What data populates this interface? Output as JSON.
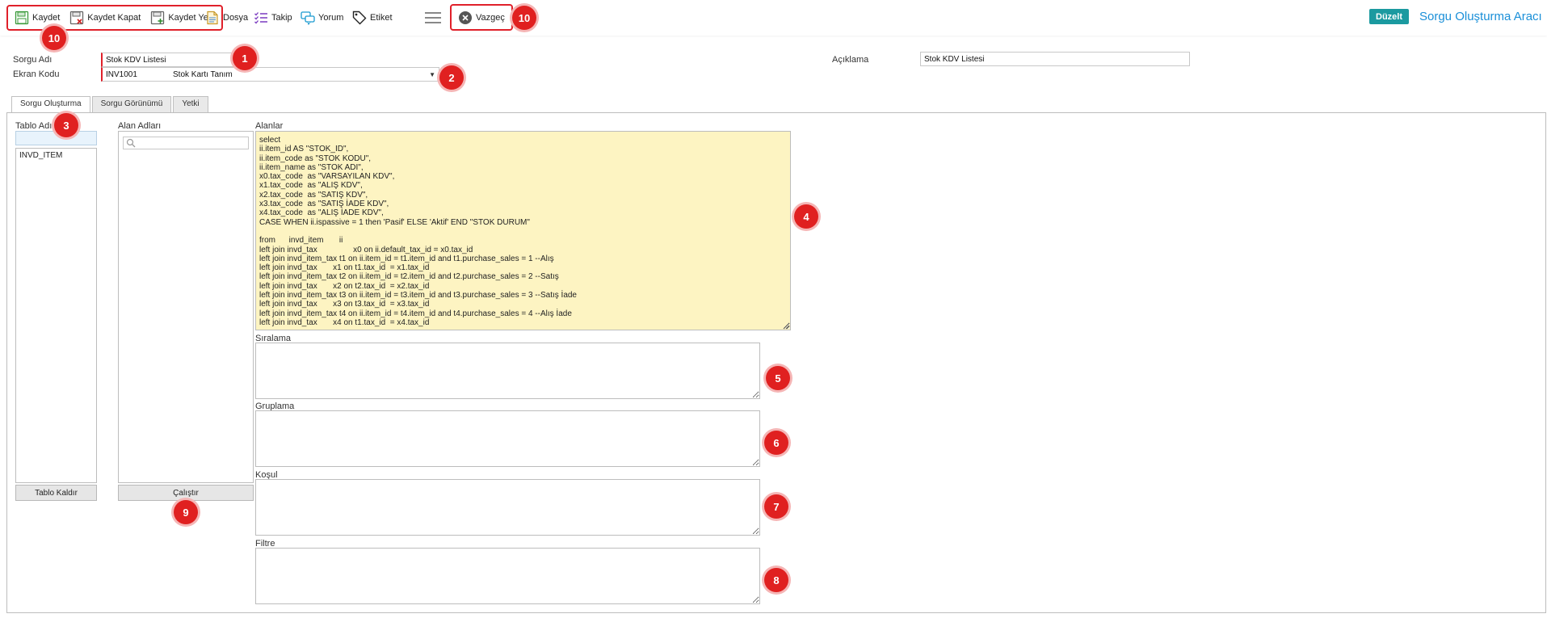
{
  "toolbar": {
    "save": "Kaydet",
    "save_close": "Kaydet Kapat",
    "save_new": "Kaydet Yeni",
    "file": "Dosya",
    "follow": "Takip",
    "comment": "Yorum",
    "tag": "Etiket",
    "cancel": "Vazgeç",
    "edit": "Düzelt",
    "app_title": "Sorgu Oluşturma Aracı"
  },
  "colors": {
    "accent": "#1b9aa0",
    "title": "#1a8fd8",
    "badge": "#e02020",
    "sql_bg": "#fdf4c2"
  },
  "form": {
    "query_name_label": "Sorgu Adı",
    "query_name_value": "Stok KDV Listesi",
    "screen_code_label": "Ekran Kodu",
    "screen_code_value": "INV1001",
    "screen_code_desc": "Stok Kartı Tanım",
    "description_label": "Açıklama",
    "description_value": "Stok KDV Listesi"
  },
  "tabs": [
    "Sorgu Oluşturma",
    "Sorgu Görünümü",
    "Yetki"
  ],
  "table_section": {
    "label": "Tablo Adı",
    "items": [
      "INVD_ITEM"
    ],
    "remove_button": "Tablo Kaldır"
  },
  "fields_section": {
    "label": "Alan Adları",
    "search_placeholder": "",
    "run_button": "Çalıştır"
  },
  "sql": {
    "label": "Alanlar",
    "text": "select\nii.item_id AS \"STOK_ID\",\nii.item_code as \"STOK KODU\",\nii.item_name as \"STOK ADI\",\nx0.tax_code  as \"VARSAYILAN KDV\",\nx1.tax_code  as \"ALIŞ KDV\",\nx2.tax_code  as \"SATIŞ KDV\",\nx3.tax_code  as \"SATIŞ İADE KDV\",\nx4.tax_code  as \"ALIŞ İADE KDV\",\nCASE WHEN ii.ispassive = 1 then 'Pasif' ELSE 'Aktif' END \"STOK DURUM\"\n\nfrom      invd_item       ii\nleft join invd_tax                x0 on ii.default_tax_id = x0.tax_id\nleft join invd_item_tax t1 on ii.item_id = t1.item_id and t1.purchase_sales = 1 --Alış\nleft join invd_tax       x1 on t1.tax_id  = x1.tax_id\nleft join invd_item_tax t2 on ii.item_id = t2.item_id and t2.purchase_sales = 2 --Satış\nleft join invd_tax       x2 on t2.tax_id  = x2.tax_id\nleft join invd_item_tax t3 on ii.item_id = t3.item_id and t3.purchase_sales = 3 --Satış İade\nleft join invd_tax       x3 on t3.tax_id  = x3.tax_id\nleft join invd_item_tax t4 on ii.item_id = t4.item_id and t4.purchase_sales = 4 --Alış İade\nleft join invd_tax       x4 on t1.tax_id  = x4.tax_id"
  },
  "sections": {
    "order_label": "Sıralama",
    "group_label": "Gruplama",
    "condition_label": "Koşul",
    "filter_label": "Filtre"
  },
  "badges": [
    "1",
    "2",
    "3",
    "4",
    "5",
    "6",
    "7",
    "8",
    "9",
    "10",
    "10"
  ]
}
